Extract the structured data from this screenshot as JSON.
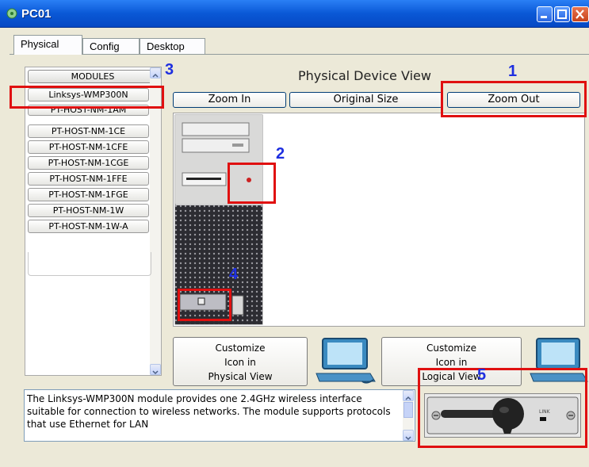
{
  "window": {
    "title": "PC01"
  },
  "tabs": [
    {
      "label": "Physical",
      "active": true
    },
    {
      "label": "Config",
      "active": false
    },
    {
      "label": "Desktop",
      "active": false
    }
  ],
  "modules": {
    "header": "MODULES",
    "items": [
      "Linksys-WMP300N",
      "PT-HOST-NM-1AM",
      "PT-HOST-NM-1CE",
      "PT-HOST-NM-1CFE",
      "PT-HOST-NM-1CGE",
      "PT-HOST-NM-1FFE",
      "PT-HOST-NM-1FGE",
      "PT-HOST-NM-1W",
      "PT-HOST-NM-1W-A"
    ]
  },
  "device_view": {
    "title": "Physical Device View",
    "zoom_in": "Zoom In",
    "original_size": "Original Size",
    "zoom_out": "Zoom Out"
  },
  "customize": {
    "physical": [
      "Customize",
      "Icon in",
      "Physical View"
    ],
    "logical": [
      "Customize",
      "Icon in",
      "Logical View"
    ]
  },
  "description": "The Linksys-WMP300N module provides one 2.4GHz wireless interface suitable for connection to wireless networks. The module supports protocols that use Ethernet for LAN",
  "module_image": {
    "link_label": "LINK"
  },
  "annotations": {
    "m1": "1",
    "m2": "2",
    "m3": "3",
    "m4": "4",
    "m5": "5"
  },
  "colors": {
    "highlight": "#e01010",
    "marker": "#1e2fe0",
    "titlebar": "#0a58d6"
  }
}
